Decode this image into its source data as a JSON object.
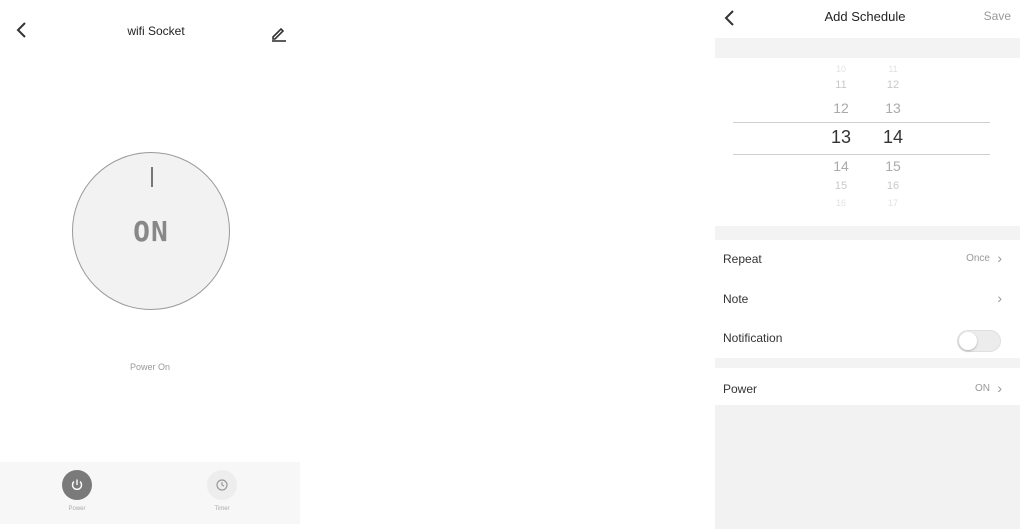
{
  "device_screen": {
    "title": "wifi Socket",
    "power_state": "ON",
    "status_text": "Power On",
    "tabs": [
      {
        "label": "Power",
        "icon": "power-icon",
        "active": true
      },
      {
        "label": "Timer",
        "icon": "timer-icon",
        "active": false
      }
    ]
  },
  "schedule_screen": {
    "title": "Add Schedule",
    "save_label": "Save",
    "picker": {
      "hours": [
        "10",
        "11",
        "12",
        "13",
        "14",
        "15",
        "16"
      ],
      "minutes": [
        "11",
        "12",
        "13",
        "14",
        "15",
        "16",
        "17"
      ],
      "selected_hour": "13",
      "selected_minute": "14"
    },
    "rows": {
      "repeat": {
        "label": "Repeat",
        "value": "Once"
      },
      "note": {
        "label": "Note",
        "value": ""
      },
      "notification": {
        "label": "Notification",
        "enabled": false
      },
      "power": {
        "label": "Power",
        "value": "ON"
      }
    }
  },
  "colors": {
    "accent_gray": "#7a7a7a",
    "background": "#ffffff",
    "band": "#f3f3f3"
  }
}
